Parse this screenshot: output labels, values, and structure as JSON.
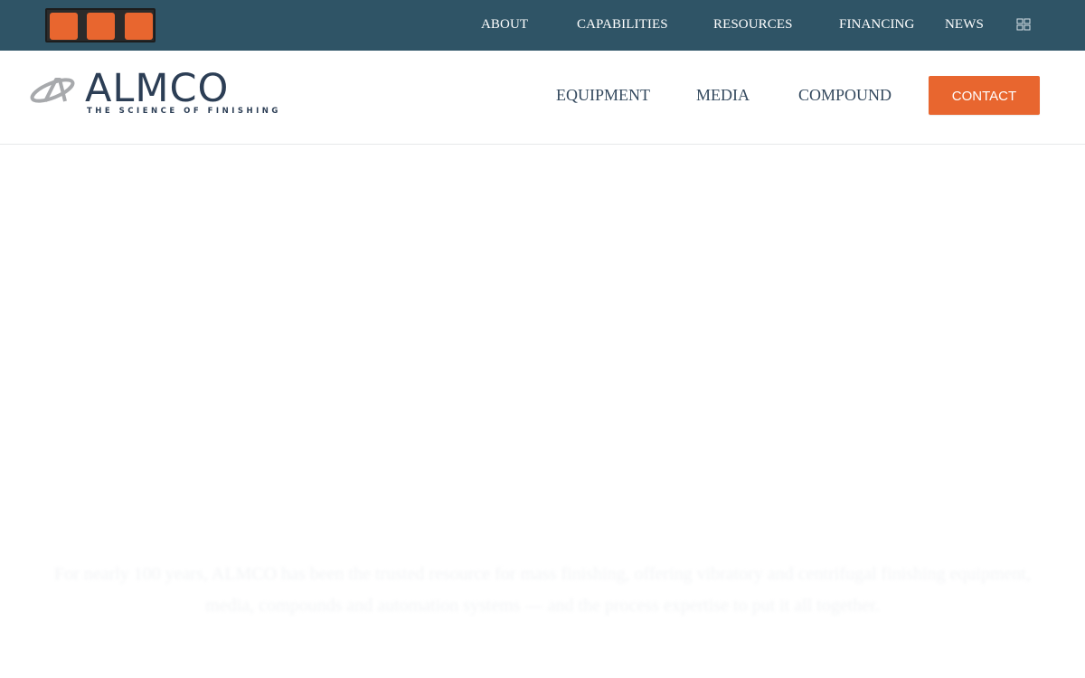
{
  "topbar": {
    "social_icons": [
      "social-icon-1",
      "social-icon-2",
      "social-icon-3"
    ],
    "links": {
      "about": "ABOUT",
      "capabilities": "CAPABILITIES",
      "resources": "RESOURCES",
      "financing": "FINANCING",
      "news": "NEWS"
    },
    "language_icon": "flag-icon",
    "background_color": "#2f5466",
    "social_color": "#e8662f"
  },
  "header": {
    "logo": {
      "word": "ALMCO",
      "tagline": "THE SCIENCE OF FINISHING"
    },
    "nav": {
      "equipment": "EQUIPMENT",
      "media": "MEDIA",
      "compound": "COMPOUND"
    },
    "contact_label": "CONTACT",
    "accent_color": "#e8662f"
  },
  "hero": {
    "intro_text": "For nearly 100 years, ALMCO has been the trusted resource for mass finishing, offering vibratory and centrifugal finishing equipment, media, compounds and automation systems — and the process expertise to put it all together."
  }
}
